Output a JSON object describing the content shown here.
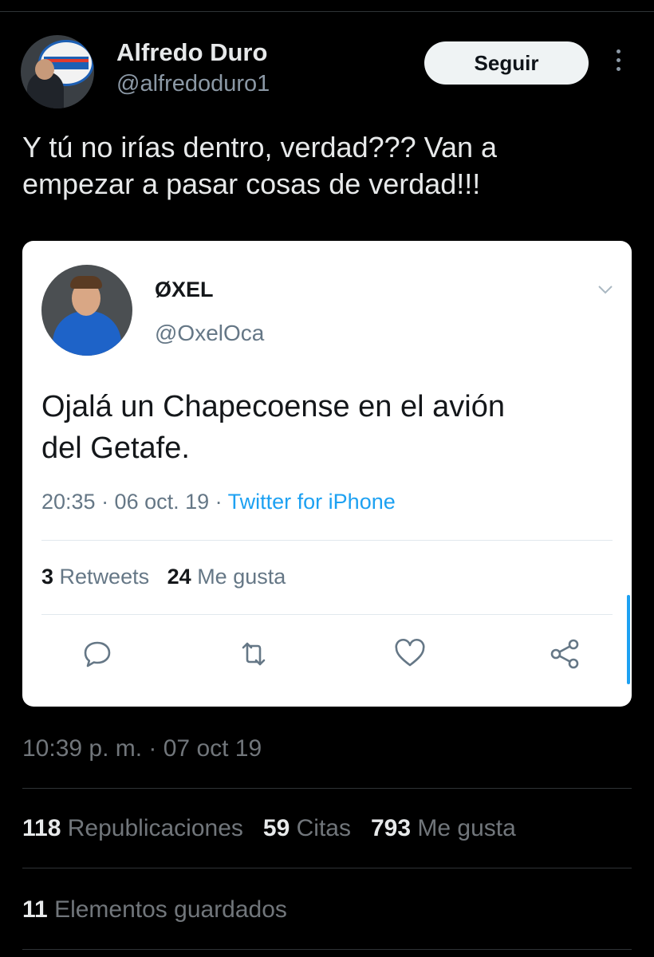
{
  "author": {
    "name": "Alfredo Duro",
    "handle": "@alfredoduro1",
    "follow_label": "Seguir"
  },
  "tweet": {
    "text_line1": "Y tú no irías dentro, verdad??? Van a",
    "text_line2": "empezar a pasar cosas de verdad!!!"
  },
  "quoted_image": {
    "name": "ØXEL",
    "handle": "@OxelOca",
    "text_line1": "Ojalá un Chapecoense en el avión",
    "text_line2": "del Getafe.",
    "time": "20:35 · 06 oct. 19 · ",
    "source": "Twitter for iPhone",
    "retweets_count": "3",
    "retweets_label": "Retweets",
    "likes_count": "24",
    "likes_label": "Me gusta",
    "accent_color": "#1da1f2"
  },
  "meta": {
    "timestamp": "10:39 p. m. · 07 oct 19"
  },
  "stats": {
    "reposts_count": "118",
    "reposts_label": "Republicaciones",
    "quotes_count": "59",
    "quotes_label": "Citas",
    "likes_count": "793",
    "likes_label": "Me gusta",
    "bookmarks_count": "11",
    "bookmarks_label": "Elementos guardados"
  },
  "icons": {
    "more": "more-options-icon",
    "reply": "reply-icon",
    "retweet": "retweet-icon",
    "like": "heart-icon",
    "share": "share-icon",
    "chevron": "chevron-down-icon"
  }
}
